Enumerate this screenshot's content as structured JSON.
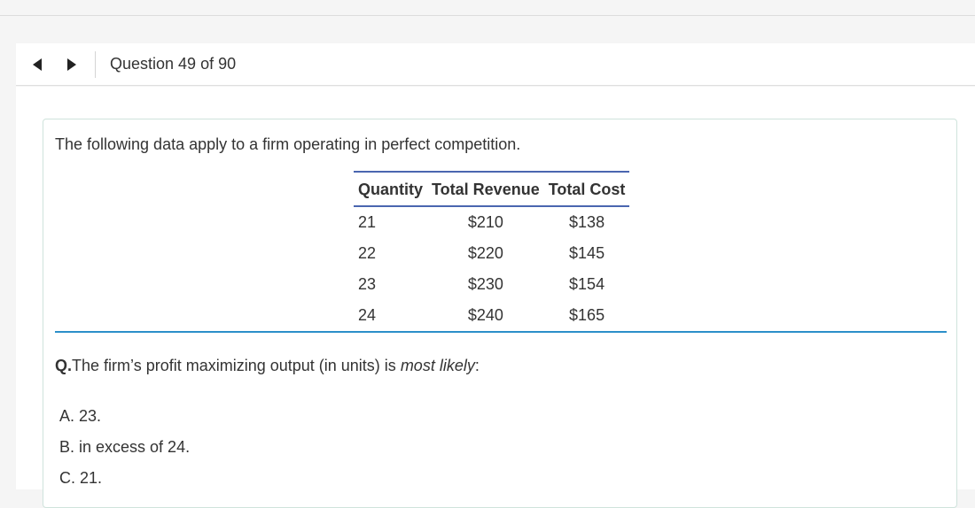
{
  "nav": {
    "question_counter": "Question 49 of 90"
  },
  "question": {
    "intro": "The following data apply to a firm operating in perfect competition.",
    "table": {
      "headers": [
        "Quantity",
        "Total Revenue",
        "Total Cost"
      ],
      "rows": [
        [
          "21",
          "$210",
          "$138"
        ],
        [
          "22",
          "$220",
          "$145"
        ],
        [
          "23",
          "$230",
          "$154"
        ],
        [
          "24",
          "$240",
          "$165"
        ]
      ]
    },
    "prefix": "Q.",
    "stem_before": "The firm’s profit maximizing output (in units) is ",
    "stem_emphasis": "most likely",
    "stem_after": ":",
    "options": [
      "A. 23.",
      "B. in excess of 24.",
      "C. 21."
    ]
  },
  "colors": {
    "table_rule": "#4a66b0",
    "section_rule": "#2c8fc9",
    "card_border": "#cfe3dc"
  },
  "icons": [
    "arrow-left-icon",
    "arrow-right-icon"
  ]
}
